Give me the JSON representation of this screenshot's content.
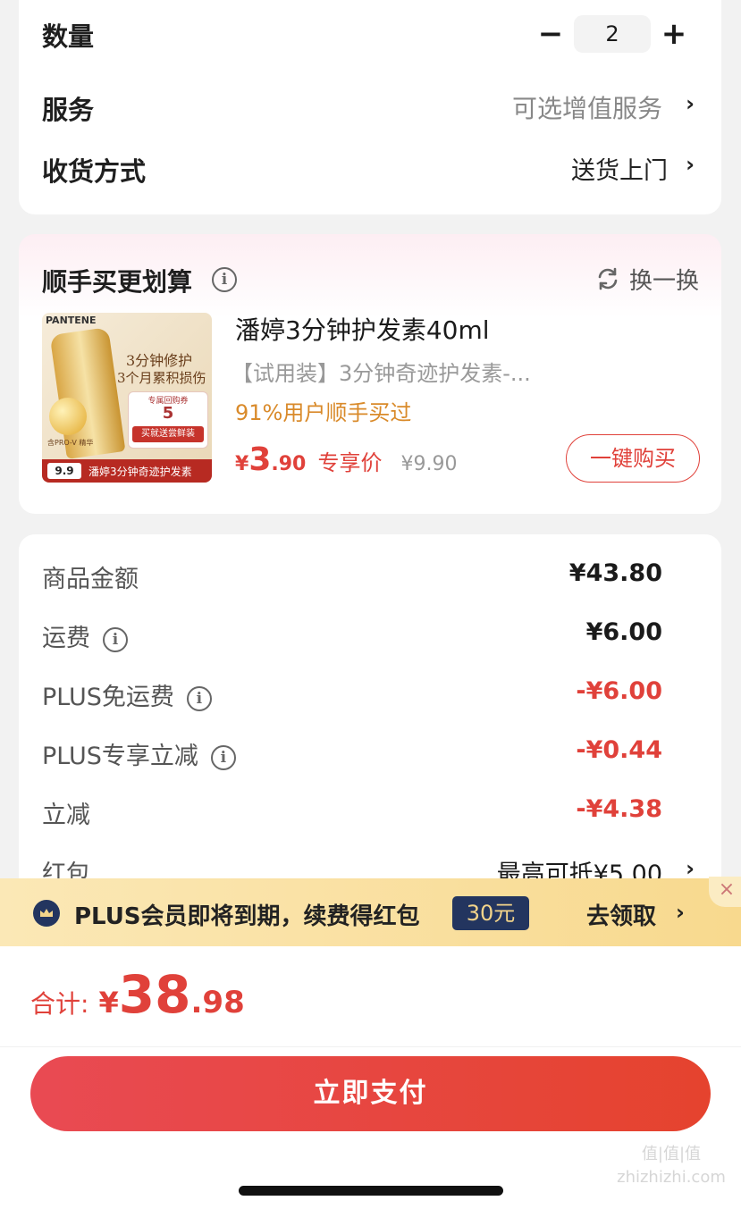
{
  "order": {
    "quantity_label": "数量",
    "quantity_value": "2",
    "minus_symbol": "−",
    "plus_symbol": "+",
    "service_label": "服务",
    "service_value": "可选增值服务",
    "delivery_label": "收货方式",
    "delivery_value": "送货上门",
    "chevron": "›"
  },
  "addon": {
    "title": "顺手买更划算",
    "info_symbol": "i",
    "refresh_label": "换一换",
    "product": {
      "name": "潘婷3分钟护发素40ml",
      "subtitle": "【试用装】3分钟奇迹护发素-...",
      "social_proof": "91%用户顺手买过",
      "price_symbol": "¥",
      "price_int": "3",
      "price_dec": ".90",
      "price_tag": "专享价",
      "original_price": "¥9.90",
      "buy_label": "一键购买",
      "image": {
        "brand": "PANTENE",
        "headline_1": "3分钟修护",
        "headline_2": "3个月累积损伤",
        "badge_top": "专属回购券",
        "badge_value": "5",
        "badge_bottom": "买就送尝鲜装",
        "bottom_banner": "潘婷3分钟奇迹护发素",
        "bottom_price": "9.9",
        "pro_v": "含PRO-V 精华"
      }
    }
  },
  "summary": {
    "rows": [
      {
        "label": "商品金额",
        "value": "¥43.80",
        "info": false,
        "red": false
      },
      {
        "label": "运费",
        "value": "¥6.00",
        "info": true,
        "red": false
      },
      {
        "label": "PLUS免运费",
        "value": "-¥6.00",
        "info": true,
        "red": true
      },
      {
        "label": "PLUS专享立减",
        "value": "-¥0.44",
        "info": true,
        "red": true
      },
      {
        "label": "立减",
        "value": "-¥4.38",
        "info": false,
        "red": true
      },
      {
        "label": "红包",
        "value": "最高可抵¥5.00",
        "info": false,
        "red": false
      }
    ]
  },
  "banner": {
    "text": "PLUS会员即将到期，续费得红包",
    "badge": "30元",
    "action": "去领取",
    "close_symbol": "×"
  },
  "footer": {
    "total_label": "合计:",
    "total_symbol": "¥",
    "total_int": "38",
    "total_dec": ".98",
    "pay_label": "立即支付"
  },
  "watermark": "值|值|值 zhizhizhi.com",
  "colors": {
    "accent_red": "#e0413a",
    "orange_text": "#d98a2a",
    "banner_bg": "#f8d98e",
    "badge_bg": "#23355f"
  }
}
